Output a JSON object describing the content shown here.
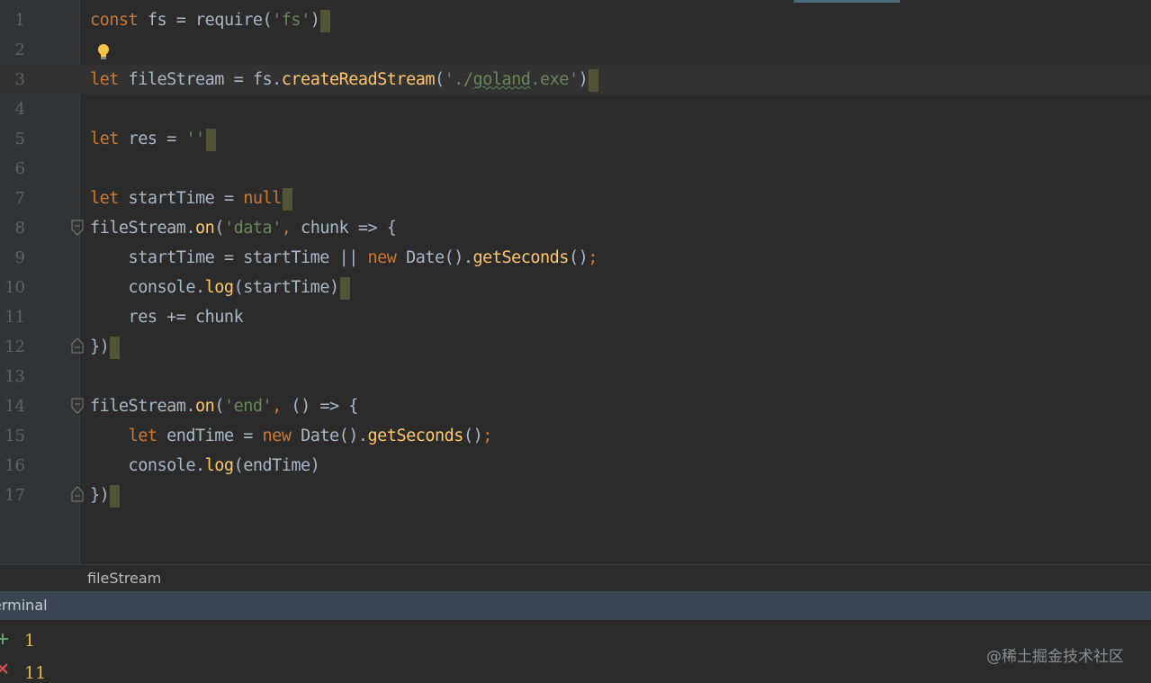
{
  "editor": {
    "lines": [
      {
        "n": "1",
        "tokens": [
          {
            "t": "const",
            "c": "kw"
          },
          {
            "t": " fs = require(",
            "c": "plain"
          },
          {
            "t": "'",
            "c": "str"
          },
          {
            "t": "fs",
            "c": "str"
          },
          {
            "t": "'",
            "c": "str"
          },
          {
            "t": ")",
            "c": "plain"
          }
        ]
      },
      {
        "n": "2",
        "tokens": []
      },
      {
        "n": "3",
        "tokens": [
          {
            "t": "let",
            "c": "kw"
          },
          {
            "t": " fileStream = fs.",
            "c": "plain"
          },
          {
            "t": "createReadStream",
            "c": "fn"
          },
          {
            "t": "(",
            "c": "plain"
          },
          {
            "t": "'./",
            "c": "str"
          },
          {
            "t": "goland",
            "c": "str-squiggle"
          },
          {
            "t": ".exe'",
            "c": "str"
          },
          {
            "t": ")",
            "c": "plain"
          }
        ]
      },
      {
        "n": "4",
        "tokens": []
      },
      {
        "n": "5",
        "tokens": [
          {
            "t": "let",
            "c": "kw"
          },
          {
            "t": " res = ",
            "c": "plain"
          },
          {
            "t": "''",
            "c": "str"
          }
        ]
      },
      {
        "n": "6",
        "tokens": []
      },
      {
        "n": "7",
        "tokens": [
          {
            "t": "let",
            "c": "kw"
          },
          {
            "t": " startTime = ",
            "c": "plain"
          },
          {
            "t": "null",
            "c": "kw"
          }
        ]
      },
      {
        "n": "8",
        "tokens": [
          {
            "t": "fileStream.",
            "c": "plain"
          },
          {
            "t": "on",
            "c": "fn"
          },
          {
            "t": "(",
            "c": "plain"
          },
          {
            "t": "'data'",
            "c": "str"
          },
          {
            "t": ",",
            "c": "kw"
          },
          {
            "t": " chunk => {",
            "c": "plain"
          }
        ]
      },
      {
        "n": "9",
        "tokens": [
          {
            "t": "    startTime = startTime || ",
            "c": "plain"
          },
          {
            "t": "new",
            "c": "kw"
          },
          {
            "t": " Date().",
            "c": "plain"
          },
          {
            "t": "getSeconds",
            "c": "fn"
          },
          {
            "t": "()",
            "c": "plain"
          },
          {
            "t": ";",
            "c": "kw"
          }
        ]
      },
      {
        "n": "10",
        "tokens": [
          {
            "t": "    console.",
            "c": "plain"
          },
          {
            "t": "log",
            "c": "fn"
          },
          {
            "t": "(startTime)",
            "c": "plain"
          }
        ]
      },
      {
        "n": "11",
        "tokens": [
          {
            "t": "    res += chunk",
            "c": "plain"
          }
        ]
      },
      {
        "n": "12",
        "tokens": [
          {
            "t": "})",
            "c": "plain"
          }
        ]
      },
      {
        "n": "13",
        "tokens": []
      },
      {
        "n": "14",
        "tokens": [
          {
            "t": "fileStream.",
            "c": "plain"
          },
          {
            "t": "on",
            "c": "fn"
          },
          {
            "t": "(",
            "c": "plain"
          },
          {
            "t": "'end'",
            "c": "str"
          },
          {
            "t": ",",
            "c": "kw"
          },
          {
            "t": " () => {",
            "c": "plain"
          }
        ]
      },
      {
        "n": "15",
        "tokens": [
          {
            "t": "    ",
            "c": "plain"
          },
          {
            "t": "let",
            "c": "kw"
          },
          {
            "t": " endTime = ",
            "c": "plain"
          },
          {
            "t": "new",
            "c": "kw"
          },
          {
            "t": " Date().",
            "c": "plain"
          },
          {
            "t": "getSeconds",
            "c": "fn"
          },
          {
            "t": "()",
            "c": "plain"
          },
          {
            "t": ";",
            "c": "kw"
          }
        ]
      },
      {
        "n": "16",
        "tokens": [
          {
            "t": "    console.",
            "c": "plain"
          },
          {
            "t": "log",
            "c": "fn"
          },
          {
            "t": "(endTime)",
            "c": "plain"
          }
        ]
      },
      {
        "n": "17",
        "tokens": [
          {
            "t": "})",
            "c": "plain"
          }
        ]
      }
    ]
  },
  "breadcrumb": {
    "label": "fileStream"
  },
  "terminal": {
    "title": "erminal",
    "output": [
      "1",
      "11"
    ]
  },
  "watermark": "@稀土掘金技术社区",
  "colors": {
    "keyword": "#cc7832",
    "string": "#6a8759",
    "function": "#ffc66d",
    "text": "#a9b7c6",
    "background": "#2b2b2b",
    "terminal_header": "#3c4553"
  }
}
